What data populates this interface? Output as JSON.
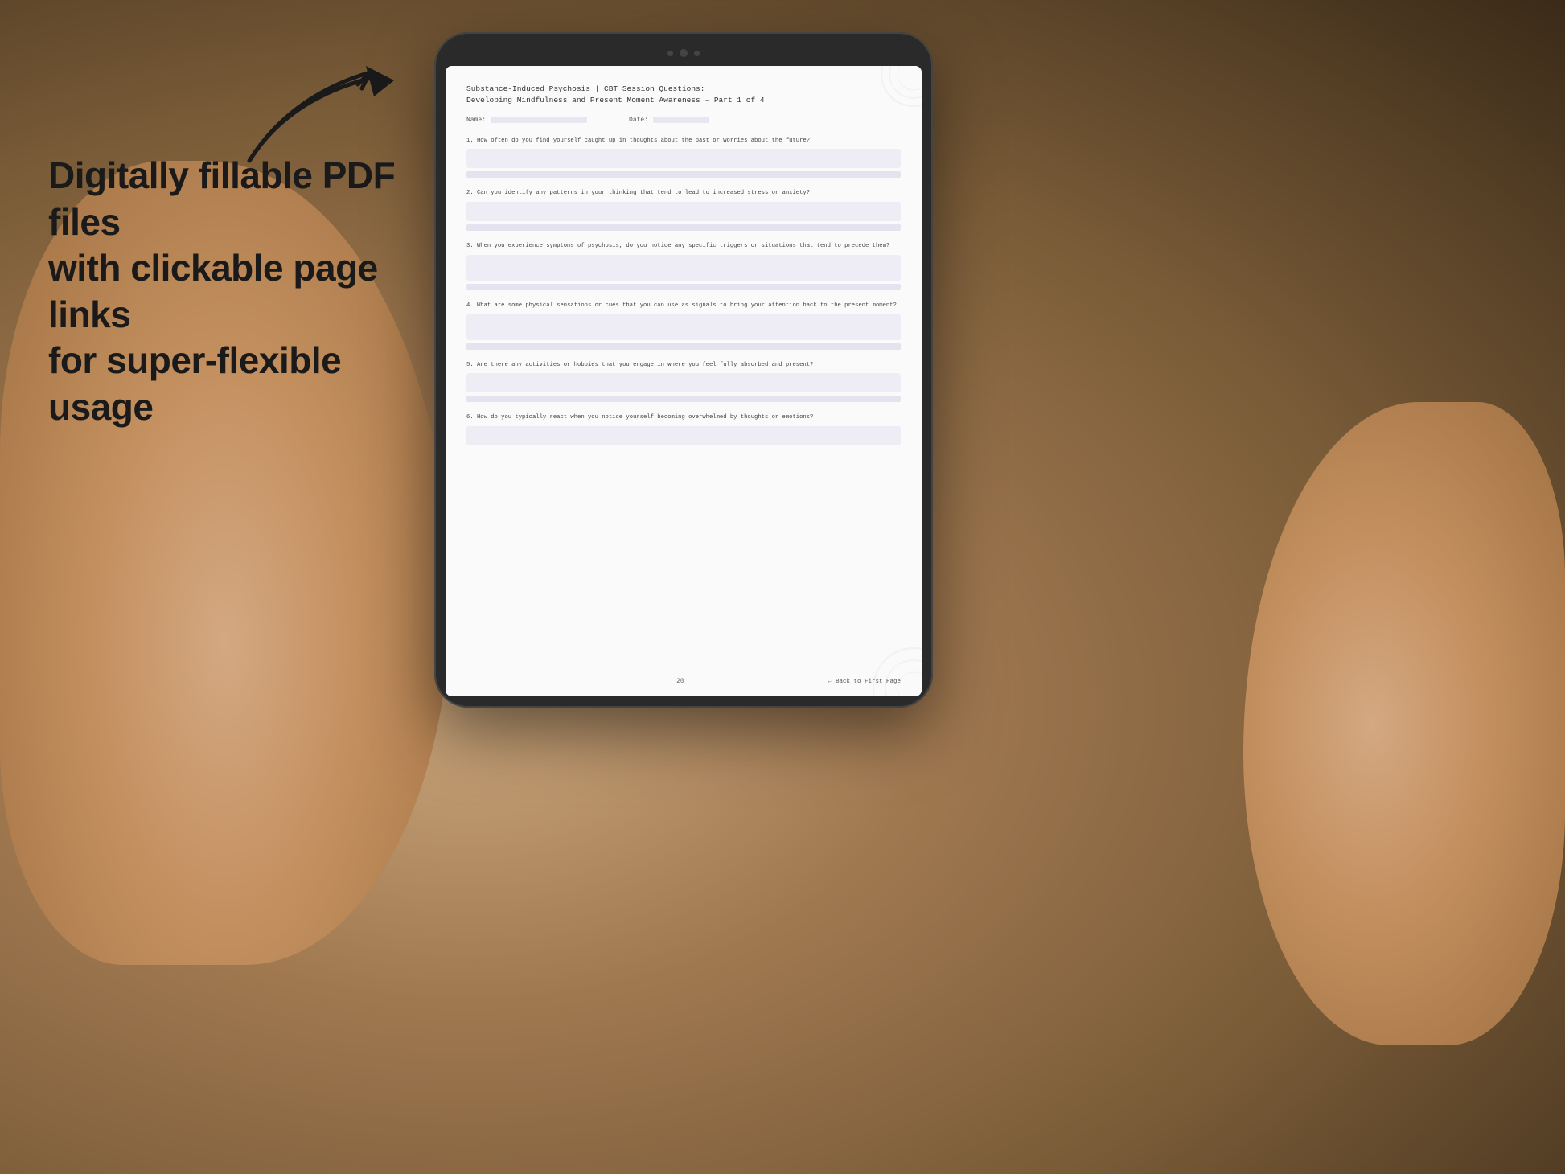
{
  "background": {
    "color": "#b8956a"
  },
  "promo": {
    "line1": "Digitally fillable PDF files",
    "line2": "with clickable page links",
    "line3": "for super-flexible usage"
  },
  "tablet": {
    "cameras": [
      "camera1",
      "camera2",
      "camera3"
    ]
  },
  "document": {
    "title_line1": "Substance-Induced Psychosis | CBT Session Questions:",
    "title_line2": "Developing Mindfulness and Present Moment Awareness – Part 1 of 4",
    "name_label": "Name:",
    "date_label": "Date:",
    "questions": [
      {
        "number": "1.",
        "text": "How often do you find yourself caught up in thoughts about the past or worries about the future?"
      },
      {
        "number": "2.",
        "text": "Can you identify any patterns in your thinking that tend to lead to increased stress or anxiety?"
      },
      {
        "number": "3.",
        "text": "When you experience symptoms of psychosis, do you notice any specific triggers or situations that tend to precede them?"
      },
      {
        "number": "4.",
        "text": "What are some physical sensations or cues that you can use as signals to bring your attention back to the present moment?"
      },
      {
        "number": "5.",
        "text": "Are there any activities or hobbies that you engage in where you feel fully absorbed and present?"
      },
      {
        "number": "6.",
        "text": "How do you typically react when you notice yourself becoming overwhelmed by thoughts or emotions?"
      }
    ],
    "page_number": "20",
    "back_link": "← Back to First Page"
  }
}
